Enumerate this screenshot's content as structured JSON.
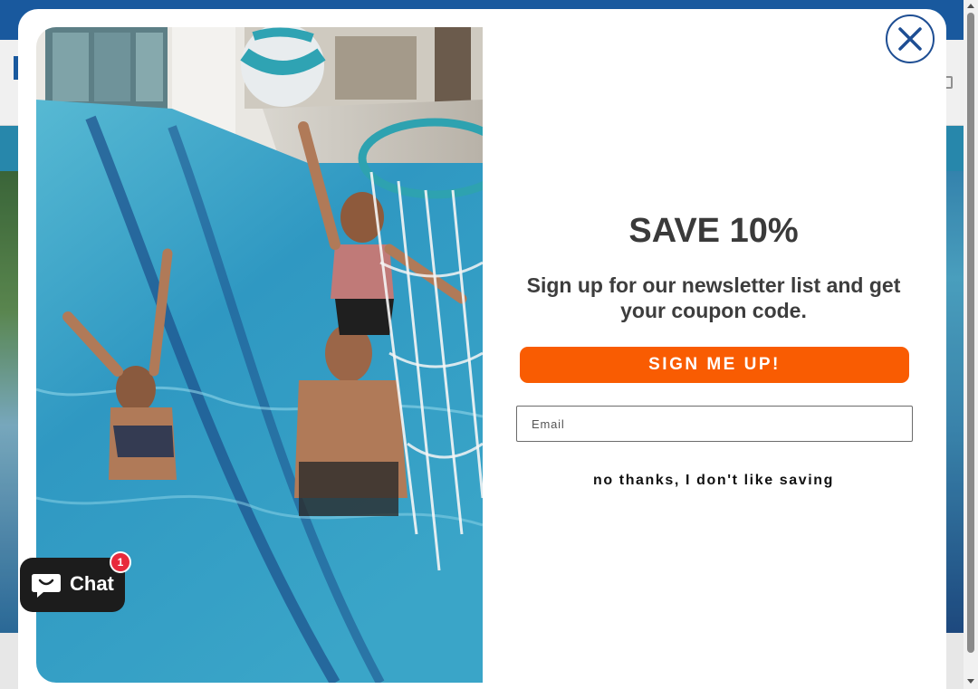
{
  "popup": {
    "title": "SAVE 10%",
    "subtitle": "Sign up for our newsletter list and get your coupon code.",
    "cta_label": "SIGN ME UP!",
    "email_placeholder": "Email",
    "email_value": "",
    "decline_label": "no thanks, I don't like saving",
    "close_icon": "close-x-circle-icon",
    "accent_color": "#f95c02",
    "close_color": "#1e4e93",
    "image": "pool-basketball-family-photo"
  },
  "chat": {
    "label": "Chat",
    "badge_count": "1",
    "icon": "chat-bubble-icon"
  },
  "theme": {
    "brand_blue": "#1b5fa8",
    "badge_red": "#e8293b"
  }
}
